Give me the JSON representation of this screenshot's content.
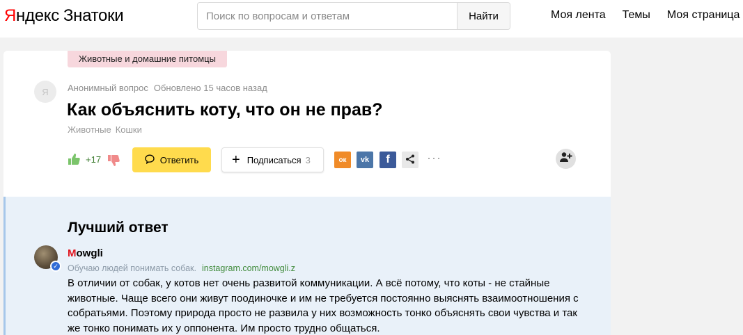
{
  "header": {
    "logo_ya": "Я",
    "logo_rest": "ндекс",
    "logo_product": "Знатоки",
    "search_placeholder": "Поиск по вопросам и ответам",
    "search_button": "Найти",
    "nav": [
      "Моя лента",
      "Темы",
      "Моя страница"
    ]
  },
  "question": {
    "category_tag": "Животные и домашние питомцы",
    "anon_avatar_letter": "Я",
    "author": "Анонимный вопрос",
    "updated": "Обновлено 15 часов назад",
    "title": "Как объяснить коту, что он не прав?",
    "topics": [
      "Животные",
      "Кошки"
    ],
    "likes": "+17",
    "answer_button": "Ответить",
    "subscribe_button": "Подписаться",
    "subscribers_count": "3",
    "share": {
      "ok_glyph": "ок",
      "vk_glyph": "vk",
      "fb_glyph": "f"
    },
    "more": "···"
  },
  "best_answer": {
    "heading": "Лучший ответ",
    "author_first_letter": "M",
    "author_rest": "owgli",
    "author_desc": "Обучаю людей понимать собак.",
    "author_link": "instagram.com/mowgli.z",
    "text": "В отличии от собак, у котов нет очень развитой коммуникации. А всё потому, что коты - не стайные животные. Чаще всего они живут поодиночке и им не требуется постоянно выяснять взаимоотношения с собратьями. Поэтому природа просто не развила у них возможность тонко объяснять свои чувства и так же тонко понимать их у оппонента. Им просто трудно общаться."
  },
  "colors": {
    "accent_yellow": "#ffdb4d",
    "tag_bg": "#f7d7dd",
    "best_bg": "#e9f1f9",
    "likes_green": "#3a7a2c"
  },
  "icons": [
    "thumb-up-icon",
    "thumb-down-icon",
    "chat-icon",
    "plus-icon",
    "share-icon",
    "add-user-icon",
    "verified-icon"
  ]
}
